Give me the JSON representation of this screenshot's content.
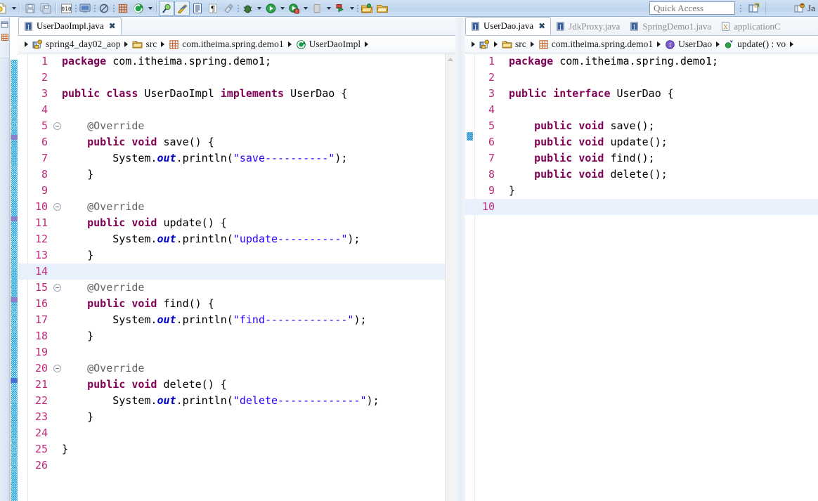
{
  "window": {
    "quick_access_placeholder": "Quick Access",
    "perspective_label": "Ja"
  },
  "toolbar": {
    "items": [
      {
        "name": "new-wizard-dropdown-icon",
        "glyph": "new"
      },
      {
        "name": "save-icon",
        "glyph": "save"
      },
      {
        "name": "save-all-icon",
        "glyph": "saveall"
      },
      {
        "name": "toggle-breakpoint-icon",
        "glyph": "010"
      },
      {
        "name": "open-console-icon",
        "glyph": "console"
      },
      {
        "name": "skip-all-breakpoints-icon",
        "glyph": "skipbp"
      },
      {
        "name": "new-java-package-icon",
        "glyph": "package"
      },
      {
        "name": "new-java-class-icon",
        "glyph": "class"
      },
      {
        "name": "search-icon",
        "glyph": "search"
      },
      {
        "name": "open-type-icon",
        "glyph": "opentype"
      },
      {
        "name": "open-task-icon",
        "glyph": "task"
      },
      {
        "name": "toggle-mark-occurrences-icon",
        "glyph": "occurrences"
      },
      {
        "name": "show-whitespace-icon",
        "glyph": "whitespace"
      },
      {
        "name": "link-with-editor-icon",
        "glyph": "link"
      },
      {
        "name": "debug-icon",
        "glyph": "debug"
      },
      {
        "name": "run-icon",
        "glyph": "run"
      },
      {
        "name": "run-external-tools-icon",
        "glyph": "exttools"
      },
      {
        "name": "coverage-icon",
        "glyph": "coverage"
      },
      {
        "name": "run-last-tool-icon",
        "glyph": "lasttool"
      },
      {
        "name": "open-folder-icon",
        "glyph": "folder1"
      },
      {
        "name": "open-folder-2-icon",
        "glyph": "folder2"
      }
    ]
  },
  "editors": {
    "left": {
      "tabs": [
        {
          "label": "UserDaoImpl.java",
          "active": true,
          "icon": "java-file-icon",
          "closable": true
        }
      ],
      "breadcrumb": [
        {
          "label": "spring4_day02_aop",
          "icon": "java-project-icon"
        },
        {
          "label": "src",
          "icon": "source-folder-icon"
        },
        {
          "label": "com.itheima.spring.demo1",
          "icon": "package-icon"
        },
        {
          "label": "UserDaoImpl",
          "icon": "class-icon"
        }
      ],
      "current_line": 14,
      "lines": [
        {
          "n": 1,
          "fold": false,
          "tokens": [
            {
              "t": "package ",
              "c": "kw"
            },
            {
              "t": "com.itheima.spring.demo1;",
              "c": "pln"
            }
          ]
        },
        {
          "n": 2,
          "fold": false,
          "tokens": []
        },
        {
          "n": 3,
          "fold": false,
          "tokens": [
            {
              "t": "public class ",
              "c": "kw"
            },
            {
              "t": "UserDaoImpl ",
              "c": "pln"
            },
            {
              "t": "implements ",
              "c": "kw"
            },
            {
              "t": "UserDao {",
              "c": "pln"
            }
          ]
        },
        {
          "n": 4,
          "fold": false,
          "tokens": []
        },
        {
          "n": 5,
          "fold": true,
          "tokens": [
            {
              "t": "    @Override",
              "c": "ann"
            }
          ]
        },
        {
          "n": 6,
          "fold": false,
          "tokens": [
            {
              "t": "    ",
              "c": "pln"
            },
            {
              "t": "public void ",
              "c": "kw"
            },
            {
              "t": "save() {",
              "c": "pln"
            }
          ]
        },
        {
          "n": 7,
          "fold": false,
          "tokens": [
            {
              "t": "        System.",
              "c": "pln"
            },
            {
              "t": "out",
              "c": "fld"
            },
            {
              "t": ".println(",
              "c": "pln"
            },
            {
              "t": "\"save----------\"",
              "c": "str"
            },
            {
              "t": ");",
              "c": "pln"
            }
          ]
        },
        {
          "n": 8,
          "fold": false,
          "tokens": [
            {
              "t": "    }",
              "c": "pln"
            }
          ]
        },
        {
          "n": 9,
          "fold": false,
          "tokens": []
        },
        {
          "n": 10,
          "fold": true,
          "tokens": [
            {
              "t": "    @Override",
              "c": "ann"
            }
          ]
        },
        {
          "n": 11,
          "fold": false,
          "tokens": [
            {
              "t": "    ",
              "c": "pln"
            },
            {
              "t": "public void ",
              "c": "kw"
            },
            {
              "t": "update() {",
              "c": "pln"
            }
          ]
        },
        {
          "n": 12,
          "fold": false,
          "tokens": [
            {
              "t": "        System.",
              "c": "pln"
            },
            {
              "t": "out",
              "c": "fld"
            },
            {
              "t": ".println(",
              "c": "pln"
            },
            {
              "t": "\"update----------\"",
              "c": "str"
            },
            {
              "t": ");",
              "c": "pln"
            }
          ]
        },
        {
          "n": 13,
          "fold": false,
          "tokens": [
            {
              "t": "    }",
              "c": "pln"
            }
          ]
        },
        {
          "n": 14,
          "fold": false,
          "tokens": []
        },
        {
          "n": 15,
          "fold": true,
          "tokens": [
            {
              "t": "    @Override",
              "c": "ann"
            }
          ]
        },
        {
          "n": 16,
          "fold": false,
          "tokens": [
            {
              "t": "    ",
              "c": "pln"
            },
            {
              "t": "public void ",
              "c": "kw"
            },
            {
              "t": "find() {",
              "c": "pln"
            }
          ]
        },
        {
          "n": 17,
          "fold": false,
          "tokens": [
            {
              "t": "        System.",
              "c": "pln"
            },
            {
              "t": "out",
              "c": "fld"
            },
            {
              "t": ".println(",
              "c": "pln"
            },
            {
              "t": "\"find-------------\"",
              "c": "str"
            },
            {
              "t": ");",
              "c": "pln"
            }
          ]
        },
        {
          "n": 18,
          "fold": false,
          "tokens": [
            {
              "t": "    }",
              "c": "pln"
            }
          ]
        },
        {
          "n": 19,
          "fold": false,
          "tokens": []
        },
        {
          "n": 20,
          "fold": true,
          "tokens": [
            {
              "t": "    @Override",
              "c": "ann"
            }
          ]
        },
        {
          "n": 21,
          "fold": false,
          "tokens": [
            {
              "t": "    ",
              "c": "pln"
            },
            {
              "t": "public void ",
              "c": "kw"
            },
            {
              "t": "delete() {",
              "c": "pln"
            }
          ]
        },
        {
          "n": 22,
          "fold": false,
          "tokens": [
            {
              "t": "        System.",
              "c": "pln"
            },
            {
              "t": "out",
              "c": "fld"
            },
            {
              "t": ".println(",
              "c": "pln"
            },
            {
              "t": "\"delete-------------\"",
              "c": "str"
            },
            {
              "t": ");",
              "c": "pln"
            }
          ]
        },
        {
          "n": 23,
          "fold": false,
          "tokens": [
            {
              "t": "    }",
              "c": "pln"
            }
          ]
        },
        {
          "n": 24,
          "fold": false,
          "tokens": []
        },
        {
          "n": 25,
          "fold": false,
          "tokens": [
            {
              "t": "}",
              "c": "pln"
            }
          ]
        },
        {
          "n": 26,
          "fold": false,
          "tokens": []
        }
      ]
    },
    "right": {
      "tabs": [
        {
          "label": "UserDao.java",
          "active": true,
          "icon": "java-file-icon",
          "closable": true
        },
        {
          "label": "JdkProxy.java",
          "active": false,
          "icon": "java-file-icon",
          "closable": false
        },
        {
          "label": "SpringDemo1.java",
          "active": false,
          "icon": "java-file-icon",
          "closable": false
        },
        {
          "label": "applicationC",
          "active": false,
          "icon": "xml-file-icon",
          "closable": false
        }
      ],
      "breadcrumb": [
        {
          "label": "",
          "icon": "java-project-icon"
        },
        {
          "label": "src",
          "icon": "source-folder-icon"
        },
        {
          "label": "com.itheima.spring.demo1",
          "icon": "package-icon"
        },
        {
          "label": "UserDao",
          "icon": "interface-icon"
        },
        {
          "label": "update() : vo",
          "icon": "method-icon"
        }
      ],
      "current_line": 10,
      "lines": [
        {
          "n": 1,
          "fold": false,
          "tokens": [
            {
              "t": "package ",
              "c": "kw"
            },
            {
              "t": "com.itheima.spring.demo1;",
              "c": "pln"
            }
          ]
        },
        {
          "n": 2,
          "fold": false,
          "tokens": []
        },
        {
          "n": 3,
          "fold": false,
          "tokens": [
            {
              "t": "public interface ",
              "c": "kw"
            },
            {
              "t": "UserDao {",
              "c": "pln"
            }
          ]
        },
        {
          "n": 4,
          "fold": false,
          "tokens": []
        },
        {
          "n": 5,
          "fold": false,
          "tokens": [
            {
              "t": "    ",
              "c": "pln"
            },
            {
              "t": "public void ",
              "c": "kw"
            },
            {
              "t": "save();",
              "c": "pln"
            }
          ]
        },
        {
          "n": 6,
          "fold": false,
          "tokens": [
            {
              "t": "    ",
              "c": "pln"
            },
            {
              "t": "public void ",
              "c": "kw"
            },
            {
              "t": "update();",
              "c": "pln"
            }
          ]
        },
        {
          "n": 7,
          "fold": false,
          "tokens": [
            {
              "t": "    ",
              "c": "pln"
            },
            {
              "t": "public void ",
              "c": "kw"
            },
            {
              "t": "find();",
              "c": "pln"
            }
          ]
        },
        {
          "n": 8,
          "fold": false,
          "tokens": [
            {
              "t": "    ",
              "c": "pln"
            },
            {
              "t": "public void ",
              "c": "kw"
            },
            {
              "t": "delete();",
              "c": "pln"
            }
          ]
        },
        {
          "n": 9,
          "fold": false,
          "tokens": [
            {
              "t": "}",
              "c": "pln"
            }
          ]
        },
        {
          "n": 10,
          "fold": false,
          "tokens": []
        }
      ]
    }
  },
  "colors": {
    "keyword": "#7f0055",
    "string": "#2a00ff",
    "annotation": "#646464",
    "field": "#0000c0",
    "line_number": "#c0297c",
    "current_line_bg": "#e8f1fb",
    "toolbar_bg": "#c3d8ef"
  }
}
